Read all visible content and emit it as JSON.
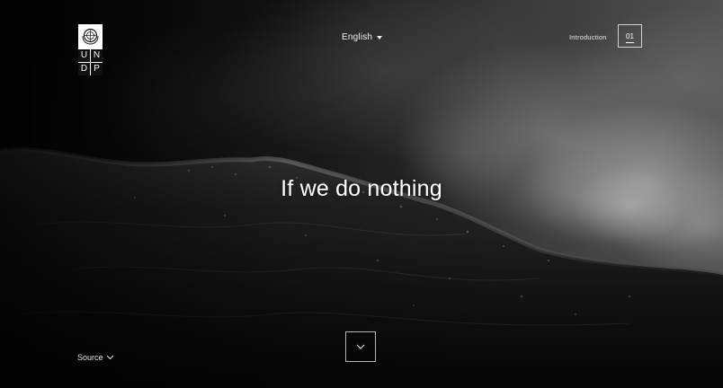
{
  "header": {
    "logo": {
      "letters": [
        "U",
        "N",
        "D",
        "P"
      ],
      "icon": "un-emblem-icon"
    },
    "language": {
      "selected": "English",
      "icon": "caret-down-icon"
    },
    "chapter": {
      "label": "Introduction",
      "number": "01"
    }
  },
  "hero": {
    "headline": "If we do nothing"
  },
  "footer": {
    "source_label": "Source",
    "source_icon": "chevron-down-icon",
    "scroll_icon": "chevron-down-icon"
  },
  "colors": {
    "text": "#ffffff",
    "background": "#0b0b0b"
  }
}
